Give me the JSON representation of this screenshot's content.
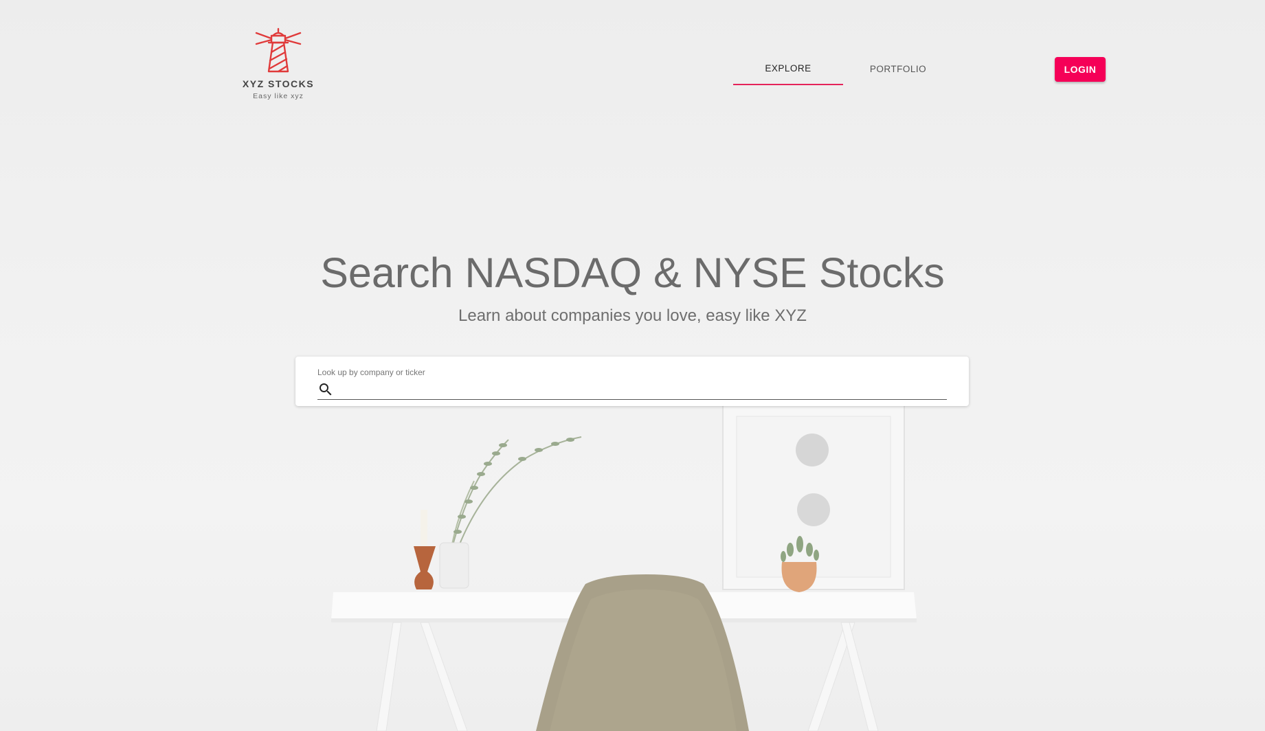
{
  "brand": {
    "name": "XYZ STOCKS",
    "tagline": "Easy like xyz",
    "logo_icon": "lighthouse-icon",
    "accent_color": "#e5235a"
  },
  "nav": {
    "tabs": [
      {
        "label": "EXPLORE",
        "active": true
      },
      {
        "label": "PORTFOLIO",
        "active": false
      }
    ]
  },
  "header": {
    "login_label": "LOGIN",
    "login_color": "#f50057"
  },
  "hero": {
    "title": "Search NASDAQ & NYSE Stocks",
    "subtitle": "Learn about companies you love, easy like XYZ"
  },
  "search": {
    "label": "Look up by company or ticker",
    "value": "",
    "icon": "search-icon"
  },
  "background": {
    "image": "desk-with-chair-and-plants-photo"
  }
}
